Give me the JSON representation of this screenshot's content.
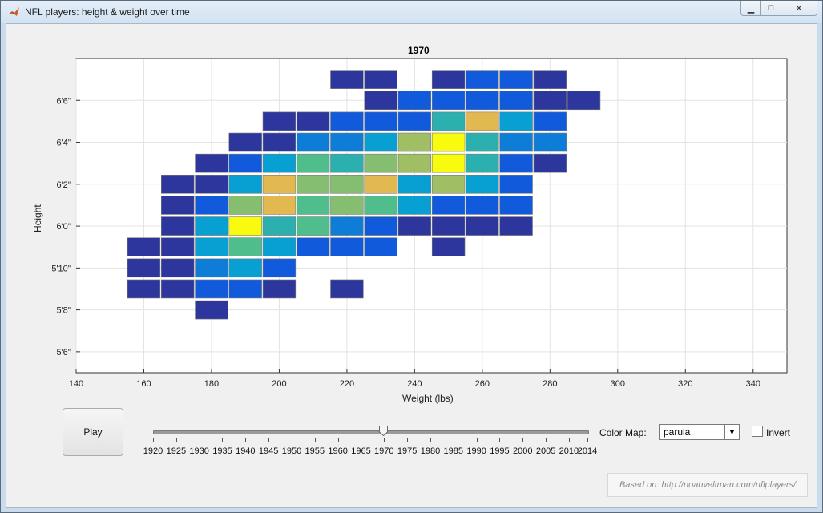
{
  "window": {
    "title": "NFL players: height & weight over time",
    "controls": [
      "minimize",
      "maximize",
      "close"
    ]
  },
  "chart_data": {
    "type": "heatmap",
    "title": "1970",
    "xlabel": "Weight (lbs)",
    "ylabel": "Height",
    "xlim": [
      140,
      350
    ],
    "ylim_inches": [
      65,
      80
    ],
    "x_ticks": [
      "140",
      "160",
      "180",
      "200",
      "220",
      "240",
      "260",
      "280",
      "300",
      "320",
      "340"
    ],
    "y_ticks": [
      "6'6''",
      "6'4''",
      "6'2''",
      "6'0''",
      "5'10''",
      "5'8''",
      "5'6''"
    ],
    "grid": true,
    "colormap": "parula",
    "cell_width_lbs": 5,
    "cell_height_in": 1,
    "cells": [
      {
        "w": 160,
        "h": 71,
        "v": 0.05
      },
      {
        "w": 160,
        "h": 70,
        "v": 0.05
      },
      {
        "w": 160,
        "h": 69,
        "v": 0.05
      },
      {
        "w": 170,
        "h": 74,
        "v": 0.05
      },
      {
        "w": 170,
        "h": 73,
        "v": 0.05
      },
      {
        "w": 170,
        "h": 72,
        "v": 0.05
      },
      {
        "w": 170,
        "h": 71,
        "v": 0.05
      },
      {
        "w": 170,
        "h": 70,
        "v": 0.05
      },
      {
        "w": 170,
        "h": 69,
        "v": 0.05
      },
      {
        "w": 180,
        "h": 75,
        "v": 0.05
      },
      {
        "w": 180,
        "h": 74,
        "v": 0.05
      },
      {
        "w": 180,
        "h": 73,
        "v": 0.2
      },
      {
        "w": 180,
        "h": 72,
        "v": 0.4
      },
      {
        "w": 180,
        "h": 71,
        "v": 0.4
      },
      {
        "w": 180,
        "h": 70,
        "v": 0.3
      },
      {
        "w": 180,
        "h": 69,
        "v": 0.2
      },
      {
        "w": 180,
        "h": 68,
        "v": 0.05
      },
      {
        "w": 190,
        "h": 76,
        "v": 0.05
      },
      {
        "w": 190,
        "h": 75,
        "v": 0.2
      },
      {
        "w": 190,
        "h": 74,
        "v": 0.4
      },
      {
        "w": 190,
        "h": 73,
        "v": 0.7
      },
      {
        "w": 190,
        "h": 72,
        "v": 1.0
      },
      {
        "w": 190,
        "h": 71,
        "v": 0.6
      },
      {
        "w": 190,
        "h": 70,
        "v": 0.4
      },
      {
        "w": 190,
        "h": 69,
        "v": 0.2
      },
      {
        "w": 200,
        "h": 77,
        "v": 0.05
      },
      {
        "w": 200,
        "h": 76,
        "v": 0.05
      },
      {
        "w": 200,
        "h": 75,
        "v": 0.4
      },
      {
        "w": 200,
        "h": 74,
        "v": 0.85
      },
      {
        "w": 200,
        "h": 73,
        "v": 0.85
      },
      {
        "w": 200,
        "h": 72,
        "v": 0.5
      },
      {
        "w": 200,
        "h": 71,
        "v": 0.4
      },
      {
        "w": 200,
        "h": 70,
        "v": 0.2
      },
      {
        "w": 200,
        "h": 69,
        "v": 0.05
      },
      {
        "w": 210,
        "h": 77,
        "v": 0.05
      },
      {
        "w": 210,
        "h": 76,
        "v": 0.3
      },
      {
        "w": 210,
        "h": 75,
        "v": 0.6
      },
      {
        "w": 210,
        "h": 74,
        "v": 0.7
      },
      {
        "w": 210,
        "h": 73,
        "v": 0.6
      },
      {
        "w": 210,
        "h": 72,
        "v": 0.6
      },
      {
        "w": 210,
        "h": 71,
        "v": 0.2
      },
      {
        "w": 220,
        "h": 79,
        "v": 0.05
      },
      {
        "w": 220,
        "h": 77,
        "v": 0.2
      },
      {
        "w": 220,
        "h": 76,
        "v": 0.3
      },
      {
        "w": 220,
        "h": 75,
        "v": 0.5
      },
      {
        "w": 220,
        "h": 74,
        "v": 0.7
      },
      {
        "w": 220,
        "h": 73,
        "v": 0.7
      },
      {
        "w": 220,
        "h": 72,
        "v": 0.3
      },
      {
        "w": 220,
        "h": 71,
        "v": 0.2
      },
      {
        "w": 220,
        "h": 69,
        "v": 0.05
      },
      {
        "w": 230,
        "h": 79,
        "v": 0.05
      },
      {
        "w": 230,
        "h": 78,
        "v": 0.05
      },
      {
        "w": 230,
        "h": 77,
        "v": 0.2
      },
      {
        "w": 230,
        "h": 76,
        "v": 0.4
      },
      {
        "w": 230,
        "h": 75,
        "v": 0.7
      },
      {
        "w": 230,
        "h": 74,
        "v": 0.85
      },
      {
        "w": 230,
        "h": 73,
        "v": 0.6
      },
      {
        "w": 230,
        "h": 72,
        "v": 0.2
      },
      {
        "w": 230,
        "h": 71,
        "v": 0.2
      },
      {
        "w": 240,
        "h": 78,
        "v": 0.2
      },
      {
        "w": 240,
        "h": 77,
        "v": 0.2
      },
      {
        "w": 240,
        "h": 76,
        "v": 0.75
      },
      {
        "w": 240,
        "h": 75,
        "v": 0.75
      },
      {
        "w": 240,
        "h": 74,
        "v": 0.4
      },
      {
        "w": 240,
        "h": 73,
        "v": 0.4
      },
      {
        "w": 240,
        "h": 72,
        "v": 0.05
      },
      {
        "w": 250,
        "h": 79,
        "v": 0.05
      },
      {
        "w": 250,
        "h": 78,
        "v": 0.2
      },
      {
        "w": 250,
        "h": 77,
        "v": 0.5
      },
      {
        "w": 250,
        "h": 76,
        "v": 1.0
      },
      {
        "w": 250,
        "h": 75,
        "v": 1.0
      },
      {
        "w": 250,
        "h": 74,
        "v": 0.75
      },
      {
        "w": 250,
        "h": 73,
        "v": 0.2
      },
      {
        "w": 250,
        "h": 72,
        "v": 0.05
      },
      {
        "w": 250,
        "h": 71,
        "v": 0.05
      },
      {
        "w": 260,
        "h": 79,
        "v": 0.2
      },
      {
        "w": 260,
        "h": 78,
        "v": 0.2
      },
      {
        "w": 260,
        "h": 77,
        "v": 0.85
      },
      {
        "w": 260,
        "h": 76,
        "v": 0.5
      },
      {
        "w": 260,
        "h": 75,
        "v": 0.5
      },
      {
        "w": 260,
        "h": 74,
        "v": 0.4
      },
      {
        "w": 260,
        "h": 73,
        "v": 0.2
      },
      {
        "w": 260,
        "h": 72,
        "v": 0.05
      },
      {
        "w": 270,
        "h": 79,
        "v": 0.2
      },
      {
        "w": 270,
        "h": 78,
        "v": 0.2
      },
      {
        "w": 270,
        "h": 77,
        "v": 0.4
      },
      {
        "w": 270,
        "h": 76,
        "v": 0.3
      },
      {
        "w": 270,
        "h": 75,
        "v": 0.2
      },
      {
        "w": 270,
        "h": 74,
        "v": 0.2
      },
      {
        "w": 270,
        "h": 73,
        "v": 0.2
      },
      {
        "w": 270,
        "h": 72,
        "v": 0.05
      },
      {
        "w": 280,
        "h": 79,
        "v": 0.05
      },
      {
        "w": 280,
        "h": 78,
        "v": 0.05
      },
      {
        "w": 280,
        "h": 77,
        "v": 0.2
      },
      {
        "w": 280,
        "h": 76,
        "v": 0.3
      },
      {
        "w": 280,
        "h": 75,
        "v": 0.05
      },
      {
        "w": 290,
        "h": 78,
        "v": 0.05
      }
    ]
  },
  "controls": {
    "play_label": "Play",
    "slider_years": [
      "1920",
      "1925",
      "1930",
      "1935",
      "1940",
      "1945",
      "1950",
      "1955",
      "1960",
      "1965",
      "1970",
      "1975",
      "1980",
      "1985",
      "1990",
      "1995",
      "2000",
      "2005",
      "2010",
      "2014"
    ],
    "slider_value": "1970",
    "colormap_label": "Color Map:",
    "colormap_value": "parula",
    "invert_label": "Invert",
    "invert_checked": false
  },
  "credit": "Based on: http://noahveltman.com/nflplayers/"
}
